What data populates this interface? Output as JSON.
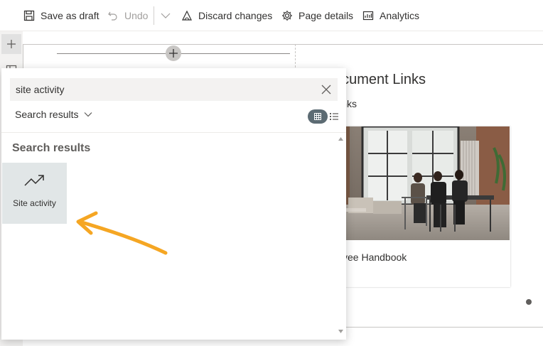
{
  "toolbar": {
    "save_draft": "Save as draft",
    "undo": "Undo",
    "discard": "Discard changes",
    "page_details": "Page details",
    "analytics": "Analytics"
  },
  "toolbox": {
    "search": {
      "value": "site activity",
      "placeholder": ""
    },
    "filter_label": "Search results",
    "results_heading": "Search results",
    "results": [
      {
        "label": "Site activity",
        "icon": "trending-up-icon"
      }
    ]
  },
  "canvas": {
    "doc_links_title": "ocument Links",
    "doc_links_subtitle": "links",
    "card_title": "yee Handbook"
  },
  "colors": {
    "annotation_arrow": "#f5a623",
    "selected_tile": "#e1e6e7",
    "view_toggle_active": "#5c6b73"
  }
}
